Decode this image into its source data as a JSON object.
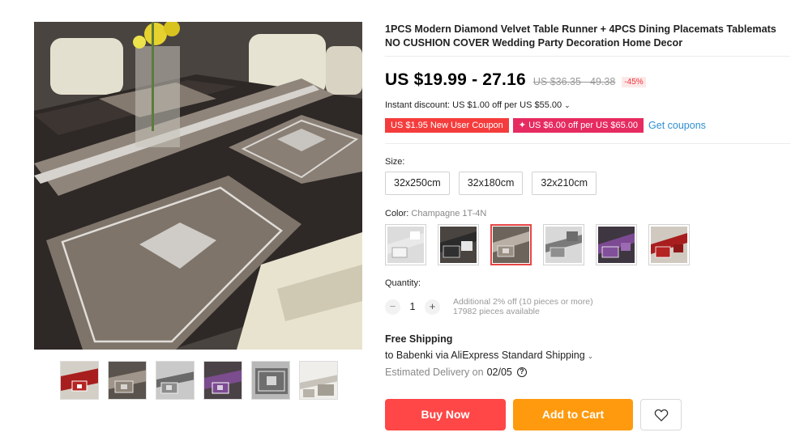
{
  "product": {
    "title": "1PCS Modern Diamond Velvet Table Runner + 4PCS Dining Placemats Tablemats NO CUSHION COVER Wedding Party Decoration Home Decor",
    "gallery_thumb_count": 6,
    "selected_thumb_index": 5
  },
  "price": {
    "current": "US $19.99 - 27.16",
    "original": "US $36.35 - 49.38",
    "discount": "-45%"
  },
  "instant_discount": {
    "text": "Instant discount: US $1.00 off per US $55.00",
    "chevron": "⌄"
  },
  "coupons": {
    "new_user": "US $1.95 New User Coupon",
    "store": "✦ US $6.00 off per US $65.00",
    "get_label": "Get coupons"
  },
  "size": {
    "label": "Size:",
    "options": [
      "32x250cm",
      "32x180cm",
      "32x210cm"
    ]
  },
  "color": {
    "label": "Color:",
    "selected_value": "Champagne 1T-4N",
    "selected_index": 2,
    "swatch_count": 6
  },
  "quantity": {
    "label": "Quantity:",
    "minus": "−",
    "plus": "+",
    "value": "1",
    "bulk_note": "Additional 2% off (10 pieces or more)",
    "available": "17982 pieces available"
  },
  "shipping": {
    "title": "Free Shipping",
    "to": "to Babenki via AliExpress Standard Shipping",
    "chevron": "⌄",
    "estimate_label": "Estimated Delivery on",
    "estimate_date": "02/05",
    "help": "?"
  },
  "actions": {
    "buy_now": "Buy Now",
    "add_to_cart": "Add to Cart",
    "wishlist_icon": "heart-outline-icon"
  },
  "colors": {
    "price_red": "#f0333a",
    "coupon_red": "#f53c3c",
    "coupon_pink": "#e62b60",
    "link_blue": "#2f8fd2",
    "buy_red": "#ff4747",
    "cart_orange": "#ff9a0e",
    "selected_border": "#e64545"
  }
}
